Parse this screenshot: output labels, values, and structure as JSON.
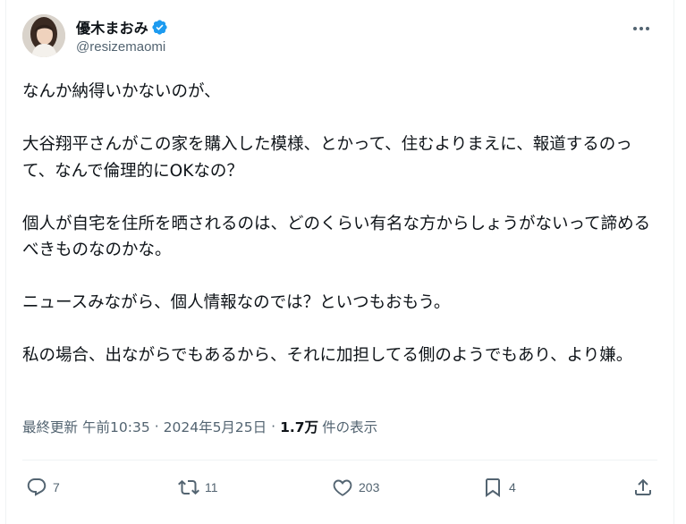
{
  "author": {
    "display_name": "優木まおみ",
    "handle": "@resizemaomi"
  },
  "post": {
    "text": "なんか納得いかないのが、\n\n大谷翔平さんがこの家を購入した模様、とかって、住むよりまえに、報道するのって、なんで倫理的にOKなの？\n\n個人が自宅を住所を晒されるのは、どのくらい有名な方からしょうがないって諦めるべきものなのかな。\n\nニュースみながら、個人情報なのでは？といつもおもう。\n\n私の場合、出ながらでもあるから、それに加担してる側のようでもあり、より嫌。"
  },
  "meta": {
    "edited_label": "最終更新",
    "time": "午前10:35",
    "separator": "·",
    "date": "2024年5月25日",
    "views_count": "1.7万",
    "views_label": "件の表示"
  },
  "actions": {
    "reply_count": "7",
    "repost_count": "11",
    "like_count": "203",
    "bookmark_count": "4"
  },
  "colors": {
    "verified_blue": "#1d9bf0",
    "secondary_text": "#536471",
    "primary_text": "#0f1419"
  },
  "icons": [
    "verified-badge-icon",
    "more-icon",
    "reply-icon",
    "repost-icon",
    "like-icon",
    "bookmark-icon",
    "share-icon"
  ]
}
